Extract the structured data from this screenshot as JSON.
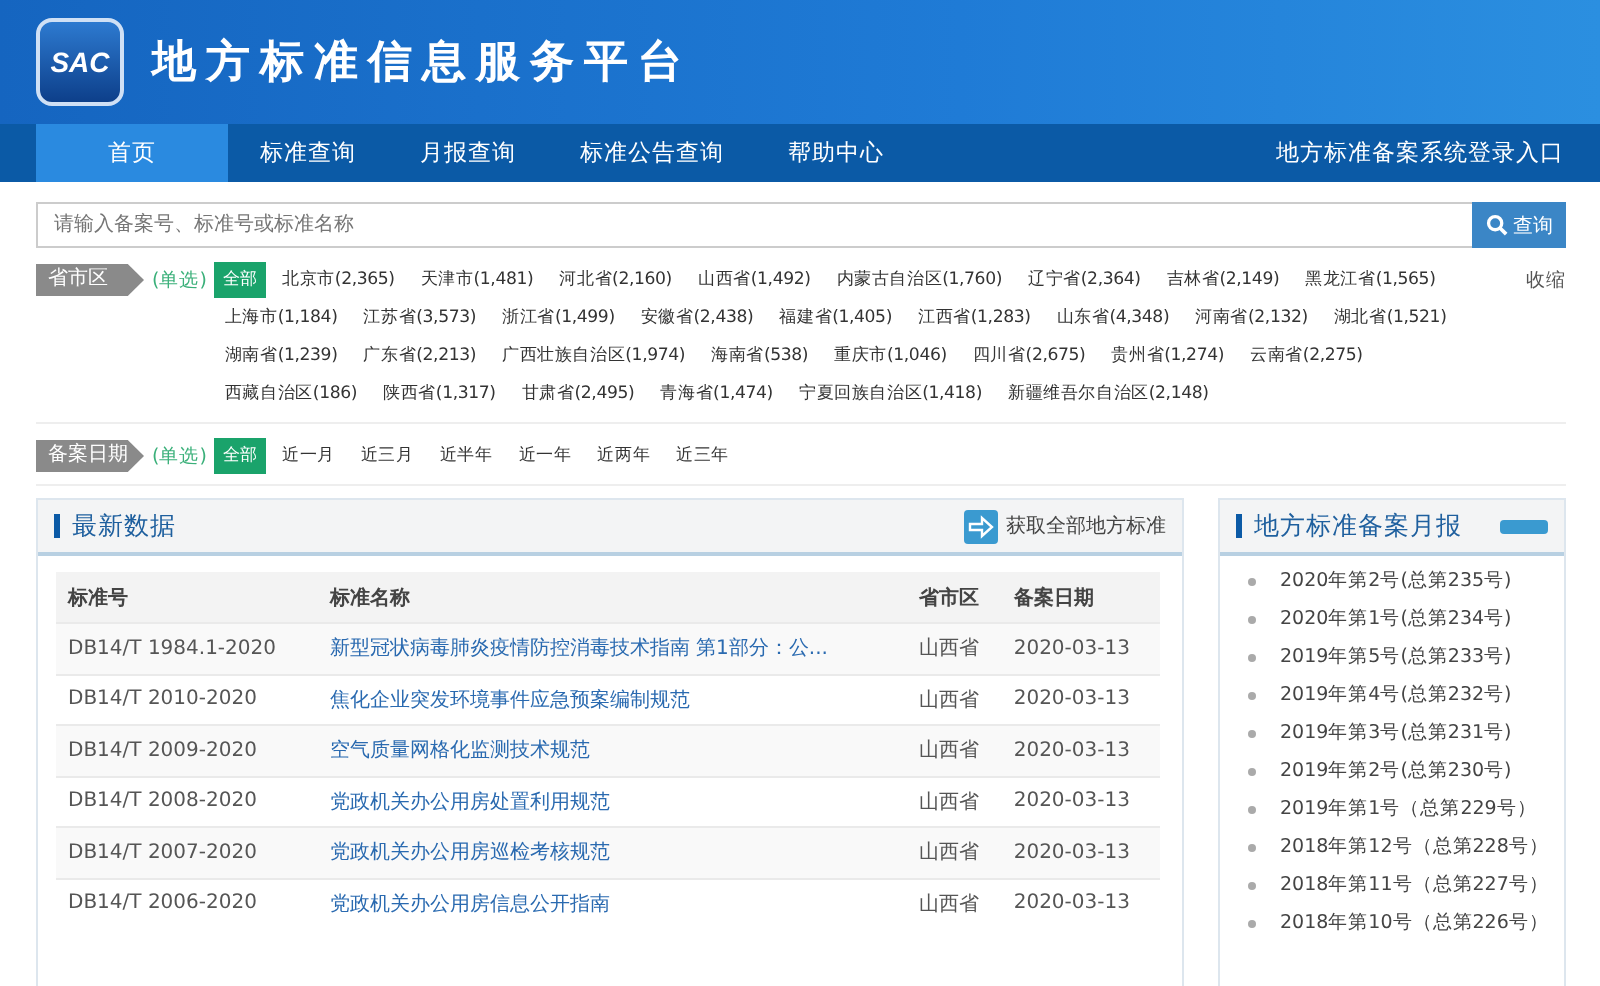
{
  "header": {
    "logo": "SAC",
    "title": "地方标准信息服务平台"
  },
  "nav": {
    "items": [
      {
        "label": "首页",
        "selected": true
      },
      {
        "label": "标准查询",
        "selected": false
      },
      {
        "label": "月报查询",
        "selected": false
      },
      {
        "label": "标准公告查询",
        "selected": false
      },
      {
        "label": "帮助中心",
        "selected": false
      }
    ],
    "login_link": "地方标准备案系统登录入口"
  },
  "search": {
    "placeholder": "请输入备案号、标准号或标准名称",
    "button": "查询"
  },
  "filters": [
    {
      "label": "省市区",
      "mode": "(单选)",
      "collapse": "收缩",
      "options": [
        {
          "label": "全部",
          "selected": true
        },
        {
          "label": "北京市(2,365)",
          "selected": false
        },
        {
          "label": "天津市(1,481)",
          "selected": false
        },
        {
          "label": "河北省(2,160)",
          "selected": false
        },
        {
          "label": "山西省(1,492)",
          "selected": false
        },
        {
          "label": "内蒙古自治区(1,760)",
          "selected": false
        },
        {
          "label": "辽宁省(2,364)",
          "selected": false
        },
        {
          "label": "吉林省(2,149)",
          "selected": false
        },
        {
          "label": "黑龙江省(1,565)",
          "selected": false
        },
        {
          "label": "上海市(1,184)",
          "selected": false
        },
        {
          "label": "江苏省(3,573)",
          "selected": false
        },
        {
          "label": "浙江省(1,499)",
          "selected": false
        },
        {
          "label": "安徽省(2,438)",
          "selected": false
        },
        {
          "label": "福建省(1,405)",
          "selected": false
        },
        {
          "label": "江西省(1,283)",
          "selected": false
        },
        {
          "label": "山东省(4,348)",
          "selected": false
        },
        {
          "label": "河南省(2,132)",
          "selected": false
        },
        {
          "label": "湖北省(1,521)",
          "selected": false
        },
        {
          "label": "湖南省(1,239)",
          "selected": false
        },
        {
          "label": "广东省(2,213)",
          "selected": false
        },
        {
          "label": "广西壮族自治区(1,974)",
          "selected": false
        },
        {
          "label": "海南省(538)",
          "selected": false
        },
        {
          "label": "重庆市(1,046)",
          "selected": false
        },
        {
          "label": "四川省(2,675)",
          "selected": false
        },
        {
          "label": "贵州省(1,274)",
          "selected": false
        },
        {
          "label": "云南省(2,275)",
          "selected": false
        },
        {
          "label": "西藏自治区(186)",
          "selected": false
        },
        {
          "label": "陕西省(1,317)",
          "selected": false
        },
        {
          "label": "甘肃省(2,495)",
          "selected": false
        },
        {
          "label": "青海省(1,474)",
          "selected": false
        },
        {
          "label": "宁夏回族自治区(1,418)",
          "selected": false
        },
        {
          "label": "新疆维吾尔自治区(2,148)",
          "selected": false
        }
      ]
    },
    {
      "label": "备案日期",
      "mode": "(单选)",
      "options": [
        {
          "label": "全部",
          "selected": true
        },
        {
          "label": "近一月",
          "selected": false
        },
        {
          "label": "近三月",
          "selected": false
        },
        {
          "label": "近半年",
          "selected": false
        },
        {
          "label": "近一年",
          "selected": false
        },
        {
          "label": "近两年",
          "selected": false
        },
        {
          "label": "近三年",
          "selected": false
        }
      ]
    }
  ],
  "latest": {
    "title": "最新数据",
    "action": "获取全部地方标准",
    "columns": [
      "标准号",
      "标准名称",
      "省市区",
      "备案日期"
    ],
    "rows": [
      [
        "DB14/T 1984.1-2020",
        "新型冠状病毒肺炎疫情防控消毒技术指南 第1部分：公...",
        "山西省",
        "2020-03-13"
      ],
      [
        "DB14/T 2010-2020",
        "焦化企业突发环境事件应急预案编制规范",
        "山西省",
        "2020-03-13"
      ],
      [
        "DB14/T 2009-2020",
        "空气质量网格化监测技术规范",
        "山西省",
        "2020-03-13"
      ],
      [
        "DB14/T 2008-2020",
        "党政机关办公用房处置利用规范",
        "山西省",
        "2020-03-13"
      ],
      [
        "DB14/T 2007-2020",
        "党政机关办公用房巡检考核规范",
        "山西省",
        "2020-03-13"
      ],
      [
        "DB14/T 2006-2020",
        "党政机关办公用房信息公开指南",
        "山西省",
        "2020-03-13"
      ]
    ]
  },
  "monthly": {
    "title": "地方标准备案月报",
    "items": [
      "2020年第2号(总第235号)",
      "2020年第1号(总第234号)",
      "2019年第5号(总第233号)",
      "2019年第4号(总第232号)",
      "2019年第3号(总第231号)",
      "2019年第2号(总第230号)",
      "2019年第1号（总第229号）",
      "2018年第12号（总第228号）",
      "2018年第11号（总第227号）",
      "2018年第10号（总第226号）"
    ]
  }
}
